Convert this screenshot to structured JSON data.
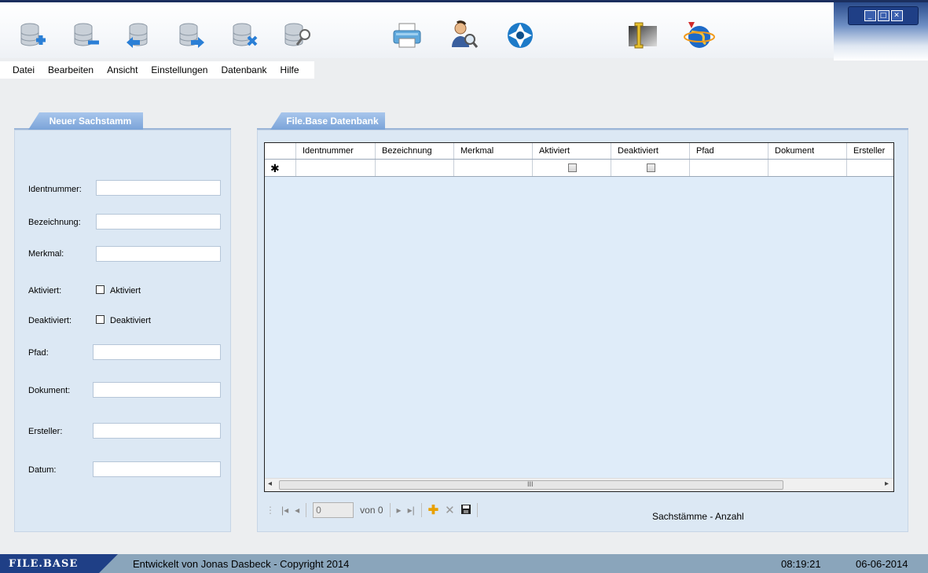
{
  "toolbar": {
    "icons": [
      "db-add-icon",
      "db-remove-icon",
      "db-back-icon",
      "db-forward-icon",
      "db-delete-icon",
      "db-search-icon",
      "printer-icon",
      "user-search-icon",
      "aperture-icon",
      "info-icon",
      "globe-icon"
    ]
  },
  "window_controls": {
    "minimize": "_",
    "maximize": "□",
    "close": "✕"
  },
  "menu": [
    "Datei",
    "Bearbeiten",
    "Ansicht",
    "Einstellungen",
    "Datenbank",
    "Hilfe"
  ],
  "left_panel": {
    "tab": "Neuer Sachstamm",
    "fields": {
      "identnummer": {
        "label": "Identnummer:",
        "value": ""
      },
      "bezeichnung": {
        "label": "Bezeichnung:",
        "value": ""
      },
      "merkmal": {
        "label": "Merkmal:",
        "value": ""
      },
      "aktiviert": {
        "label": "Aktiviert:",
        "checkbox_text": "Aktiviert"
      },
      "deaktiviert": {
        "label": "Deaktiviert:",
        "checkbox_text": "Deaktiviert"
      },
      "pfad": {
        "label": "Pfad:",
        "value": ""
      },
      "dokument": {
        "label": "Dokument:",
        "value": ""
      },
      "ersteller": {
        "label": "Ersteller:",
        "value": ""
      },
      "datum": {
        "label": "Datum:",
        "value": ""
      }
    }
  },
  "right_panel": {
    "tab": "File.Base Datenbank",
    "columns": [
      "Identnummer",
      "Bezeichnung",
      "Merkmal",
      "Aktiviert",
      "Deaktiviert",
      "Pfad",
      "Dokument",
      "Ersteller"
    ],
    "new_row_marker": "✱",
    "scroll_glyph": "III",
    "navigator": {
      "position": "0",
      "of_label": "von 0"
    },
    "count_label": "Sachstämme - Anzahl"
  },
  "status_bar": {
    "brand": "FILE.BASE",
    "credit": "Entwickelt von Jonas Dasbeck - Copyright 2014",
    "time": "08:19:21",
    "date": "06-06-2014"
  }
}
